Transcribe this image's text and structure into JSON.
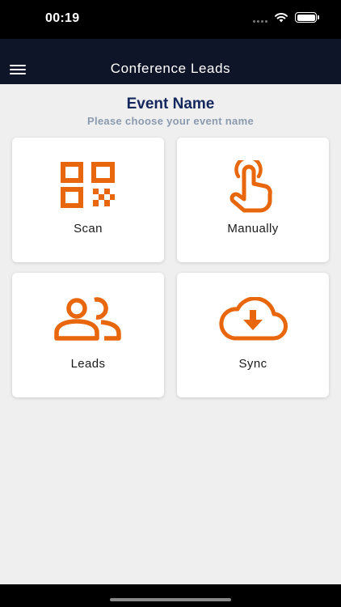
{
  "status_bar": {
    "time": "00:19"
  },
  "nav": {
    "title": "Conference Leads"
  },
  "header": {
    "event_name": "Event Name",
    "subtitle": "Please choose your event name"
  },
  "tiles": [
    {
      "label": "Scan",
      "icon": "qr-code-icon"
    },
    {
      "label": "Manually",
      "icon": "tap-hand-icon"
    },
    {
      "label": "Leads",
      "icon": "people-icon"
    },
    {
      "label": "Sync",
      "icon": "cloud-download-icon"
    }
  ],
  "colors": {
    "accent": "#e8670c",
    "nav_background": "#0f1529",
    "title_text": "#14285e",
    "subtitle_text": "#8a9bb0",
    "page_background": "#efefef"
  }
}
